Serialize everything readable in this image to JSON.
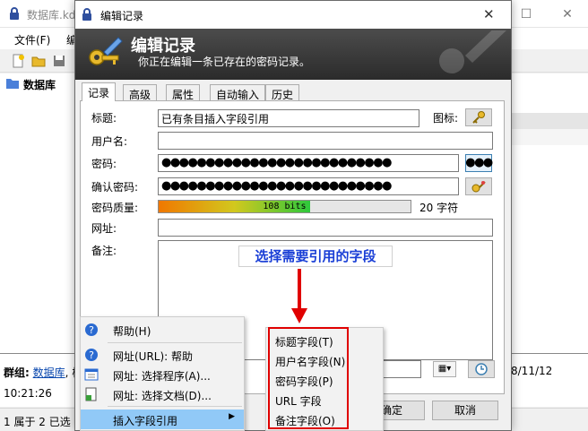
{
  "background_window": {
    "title": "数据库.kd",
    "menu": {
      "file": "文件(F)",
      "edit_fragment": "编"
    },
    "tree_root": "数据库",
    "info": {
      "group_label": "群组:",
      "group_value": "数据库",
      "group_suffix": ", 核",
      "time": "10:21:26",
      "date_fragment": "8/11/12"
    },
    "status": "1 属于 2 已选"
  },
  "dialog": {
    "title": "编辑记录",
    "banner_title": "编辑记录",
    "banner_subtitle": "你正在编辑一条已存在的密码记录。",
    "tabs": [
      "记录",
      "高级",
      "属性",
      "自动输入",
      "历史"
    ],
    "active_tab": 0,
    "fields": {
      "title_label": "标题:",
      "title_value": "已有条目插入字段引用",
      "icon_label": "图标:",
      "username_label": "用户名:",
      "username_value": "",
      "password_label": "密码:",
      "password_value": "●●●●●●●●●●●●●●●●●●●●●●●●●●",
      "reveal_button": "●●●",
      "confirm_label": "确认密码:",
      "confirm_value": "●●●●●●●●●●●●●●●●●●●●●●●●●●",
      "quality_label": "密码质量:",
      "quality_text": "108 bits",
      "quality_fraction": 0.6,
      "quality_chars": "20 字符",
      "url_label": "网址:",
      "url_value": "",
      "notes_label": "备注:"
    },
    "ok_button": "确定",
    "ok_button_visible": "确定",
    "cancel_button": "取消"
  },
  "annotation": {
    "callout_text": "选择需要引用的字段",
    "accent_color": "#e00000",
    "callout_color": "#1a3fd6"
  },
  "context_menu": {
    "items": [
      {
        "label": "帮助(H)",
        "icon": "help-icon"
      },
      {
        "label": "网址(URL): 帮助",
        "icon": "help-icon"
      },
      {
        "label": "网址: 选择程序(A)...",
        "icon": "program-icon"
      },
      {
        "label": "网址: 选择文档(D)...",
        "icon": "document-icon"
      },
      {
        "label": "插入字段引用",
        "icon": "",
        "highlighted": true
      }
    ]
  },
  "submenu": {
    "items": [
      "标题字段(T)",
      "用户名字段(N)",
      "密码字段(P)",
      "URL 字段",
      "备注字段(O)"
    ]
  }
}
